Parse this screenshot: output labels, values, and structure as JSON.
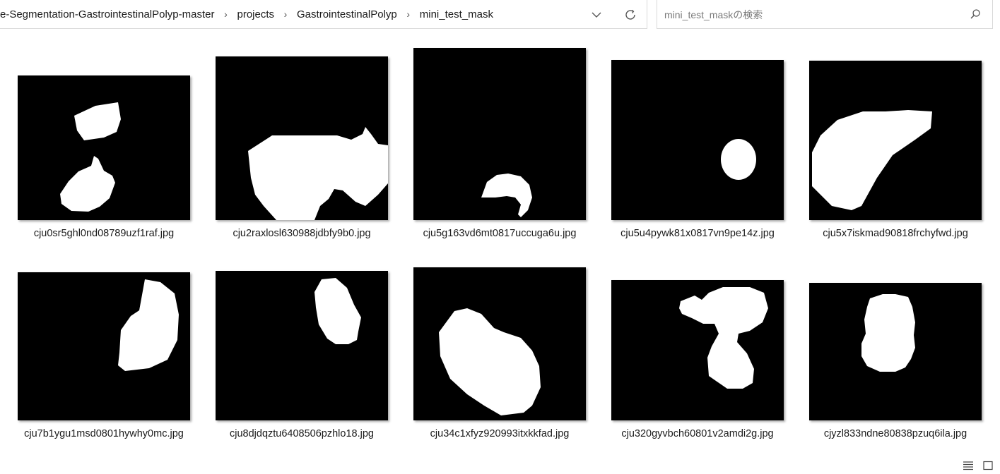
{
  "address_bar": {
    "breadcrumbs": [
      "e-Segmentation-GastrointestinalPolyp-master",
      "projects",
      "GastrointestinalPolyp",
      "mini_test_mask"
    ],
    "dropdown_icon": "chevron-down-icon",
    "refresh_icon": "refresh-icon"
  },
  "search": {
    "placeholder": "mini_test_maskの検索",
    "icon": "search-icon"
  },
  "files": [
    {
      "name": "cju0sr5ghl0nd08789uzf1raf.jpg"
    },
    {
      "name": "cju2raxlosl630988jdbfy9b0.jpg"
    },
    {
      "name": "cju5g163vd6mt0817uccuga6u.jpg"
    },
    {
      "name": "cju5u4pywk81x0817vn9pe14z.jpg"
    },
    {
      "name": "cju5x7iskmad90818frchyfwd.jpg"
    },
    {
      "name": "cju7b1ygu1msd0801hywhy0mc.jpg"
    },
    {
      "name": "cju8djdqztu6408506pzhlo18.jpg"
    },
    {
      "name": "cju34c1xfyz920993itxkkfad.jpg"
    },
    {
      "name": "cju320gyvbch60801v2amdi2g.jpg"
    },
    {
      "name": "cjyzl833ndne80838pzuq6ila.jpg"
    }
  ],
  "status_bar": {
    "details_view_icon": "details-view-icon",
    "large_icons_view_icon": "large-icons-view-icon"
  }
}
